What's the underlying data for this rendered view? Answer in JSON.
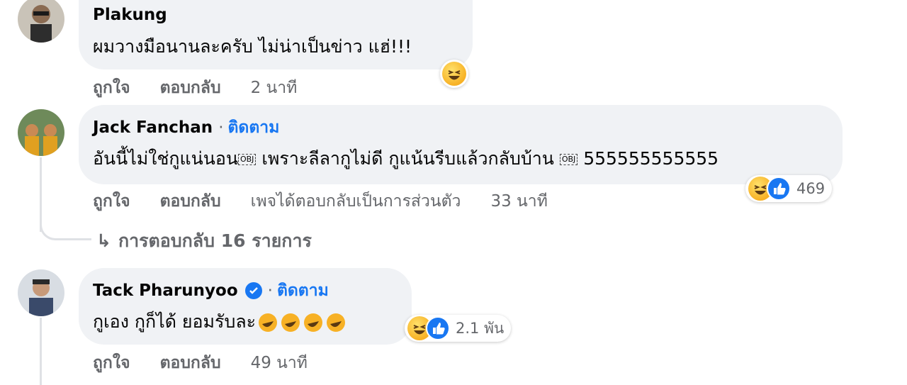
{
  "comments": [
    {
      "author": "Plakung",
      "text": "ผมวางมือนานละครับ ไม่น่าเป็นข่าว แฮ่!!!",
      "actions": {
        "like": "ถูกใจ",
        "reply": "ตอบกลับ",
        "time": "2 นาที"
      },
      "reactions": [
        "haha-icon"
      ]
    },
    {
      "author": "Jack Fanchan",
      "separator": "·",
      "follow": "ติดตาม",
      "text_parts": [
        "อันนี้ไม่ใช่กูแน่นอน",
        "OBJ",
        " เพราะลีลากูไม่ดี กูแน้นรีบแล้วกลับบ้าน ",
        "OBJ",
        " 555555555555"
      ],
      "actions": {
        "like": "ถูกใจ",
        "reply": "ตอบกลับ",
        "note": "เพจได้ตอบกลับเป็นการส่วนตัว",
        "time": "33 นาที"
      },
      "reactions": [
        "haha-icon",
        "like-icon"
      ],
      "reaction_count": "469",
      "replies_label": "การตอบกลับ 16 รายการ"
    },
    {
      "author": "Tack Pharunyoo",
      "separator": "·",
      "follow": "ติดตาม",
      "text": "กูเอง กูก็ได้ ยอมรับละ",
      "actions": {
        "like": "ถูกใจ",
        "reply": "ตอบกลับ",
        "time": "49 นาที"
      },
      "reactions": [
        "haha-icon",
        "like-icon"
      ],
      "reaction_count": "2.1 พัน",
      "inline_emoji": [
        "rofl-icon",
        "rofl-icon",
        "rofl-icon",
        "rofl-icon"
      ]
    }
  ],
  "colors": {
    "bubble": "#f0f2f5",
    "link": "#1877f2",
    "muted": "#65676b",
    "text": "#050505"
  }
}
